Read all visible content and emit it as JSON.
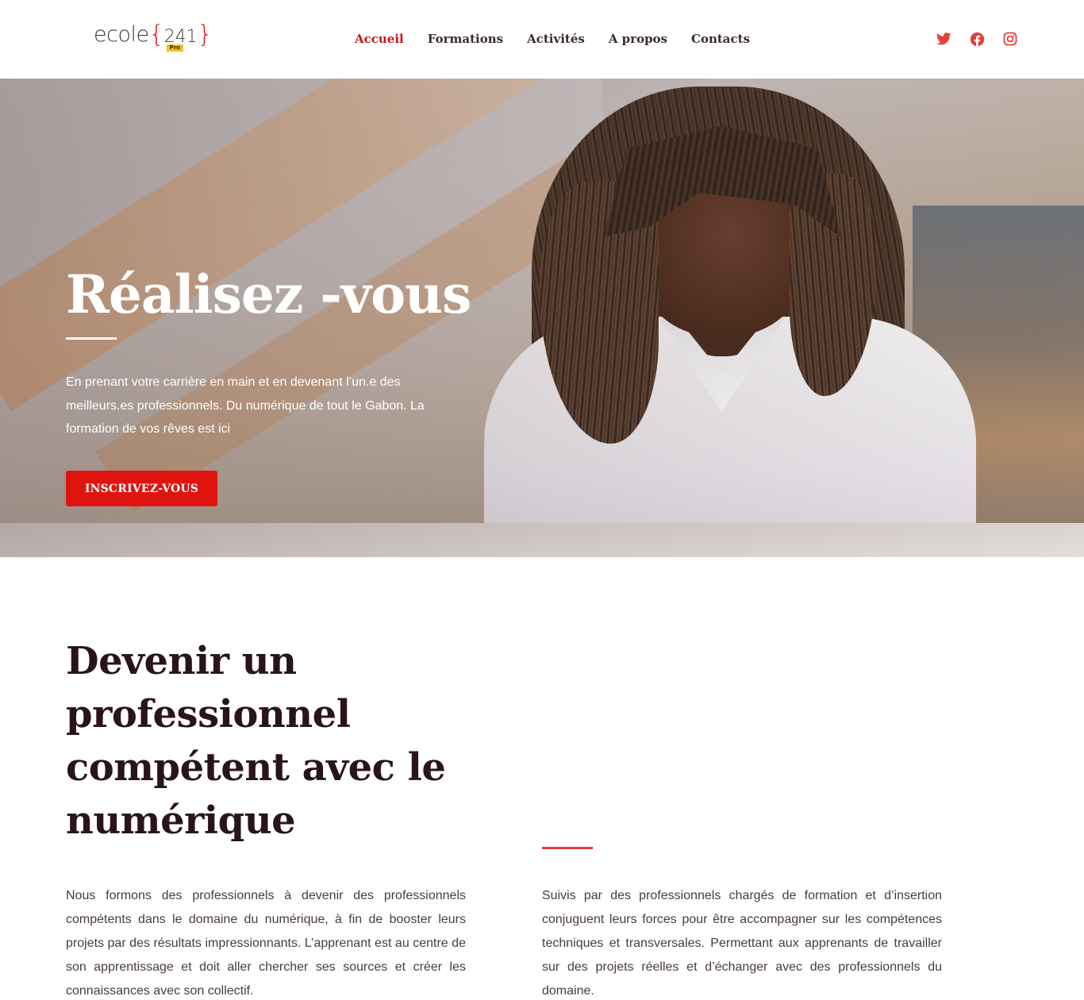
{
  "header": {
    "logo": {
      "word": "ecole",
      "brace_open": "{",
      "number": "241",
      "brace_close": "}",
      "badge": "Pro"
    },
    "nav": [
      {
        "label": "Accueil",
        "active": true
      },
      {
        "label": "Formations",
        "active": false
      },
      {
        "label": "Activités",
        "active": false
      },
      {
        "label": "A propos",
        "active": false
      },
      {
        "label": "Contacts",
        "active": false
      }
    ],
    "social": [
      "twitter-icon",
      "facebook-icon",
      "instagram-icon"
    ]
  },
  "hero": {
    "title": "Réalisez -vous",
    "text": "En prenant votre carrière en main et en devenant l’un.e des meilleurs.es professionnels. Du numérique de tout le Gabon. La formation de vos rêves est ici",
    "button_label": "INSCRIVEZ-VOUS"
  },
  "section": {
    "title": "Devenir un professionnel compétent avec le numérique",
    "left_text": "Nous formons des professionnels à devenir des professionnels compétents dans le domaine du numérique, à fin de booster leurs projets  par des résultats impressionnants. L’apprenant est au centre de son apprentissage et doit aller chercher ses sources et créer les connaissances avec son collectif.",
    "right_text": "Suivis par des professionnels chargés de formation et d’insertion conjuguent leurs forces pour être accompagner sur les compétences techniques et transversales. Permettant aux apprenants de travailler sur des projets réelles et d’échanger avec des professionnels du domaine."
  },
  "colors": {
    "accent": "#e0140f",
    "nav_active": "#c8161d",
    "heading": "#2a141b",
    "social": "#e0433c"
  }
}
